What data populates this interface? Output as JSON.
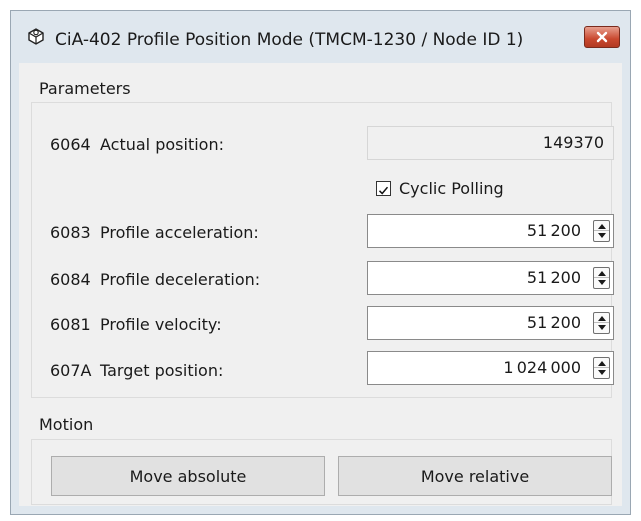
{
  "window": {
    "title": "CiA-402 Profile Position Mode (TMCM-1230 / Node ID 1)",
    "icon": "gear-box-icon",
    "close_icon": "close-icon"
  },
  "parameters": {
    "label": "Parameters",
    "actual_position": {
      "index": "6064",
      "label": "Actual position:",
      "value": "149370"
    },
    "cyclic_polling": {
      "label": "Cyclic Polling",
      "checked": true
    },
    "rows": [
      {
        "index": "6083",
        "label": "Profile acceleration:",
        "value": "51200"
      },
      {
        "index": "6084",
        "label": "Profile deceleration:",
        "value": "51200"
      },
      {
        "index": "6081",
        "label": "Profile velocity:",
        "value": "51200"
      },
      {
        "index": "607A",
        "label": "Target position:",
        "value": "1024000"
      }
    ]
  },
  "motion": {
    "label": "Motion",
    "move_absolute": "Move absolute",
    "move_relative": "Move relative"
  },
  "colors": {
    "frame": "#dfe7ee",
    "panel": "#f0f0f0",
    "close": "#c9482f"
  }
}
